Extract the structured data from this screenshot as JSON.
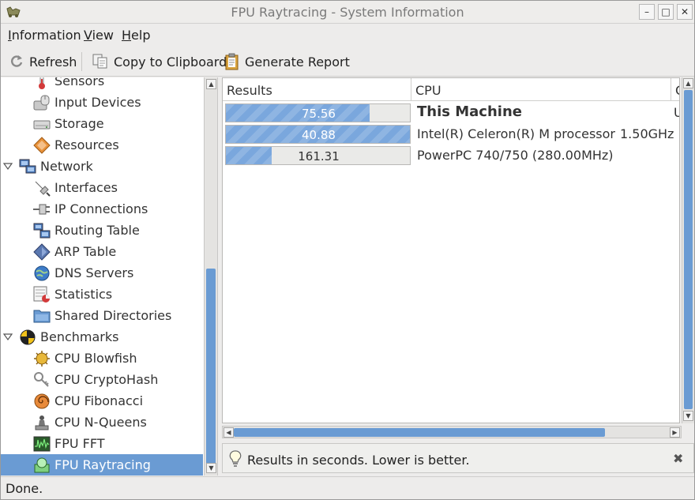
{
  "window": {
    "title": "FPU Raytracing - System Information",
    "minimize": "–",
    "maximize": "□",
    "close": "✕"
  },
  "menu": [
    {
      "mnemonic": "I",
      "rest": "nformation"
    },
    {
      "mnemonic": "V",
      "rest": "iew"
    },
    {
      "mnemonic": "H",
      "rest": "elp"
    }
  ],
  "toolbar": {
    "refresh": "Refresh",
    "copy": "Copy to Clipboard",
    "report": "Generate Report"
  },
  "sidebar": {
    "items": [
      {
        "label": "Sensors",
        "icon": "thermometer-icon"
      },
      {
        "label": "Input Devices",
        "icon": "input-devices-icon"
      },
      {
        "label": "Storage",
        "icon": "storage-icon"
      },
      {
        "label": "Resources",
        "icon": "resources-icon"
      },
      {
        "label": "Network",
        "icon": "network-icon",
        "group": true
      },
      {
        "label": "Interfaces",
        "icon": "interfaces-icon"
      },
      {
        "label": "IP Connections",
        "icon": "ip-connections-icon"
      },
      {
        "label": "Routing Table",
        "icon": "routing-table-icon"
      },
      {
        "label": "ARP Table",
        "icon": "arp-table-icon"
      },
      {
        "label": "DNS Servers",
        "icon": "dns-servers-icon"
      },
      {
        "label": "Statistics",
        "icon": "statistics-icon"
      },
      {
        "label": "Shared Directories",
        "icon": "shared-directories-icon"
      },
      {
        "label": "Benchmarks",
        "icon": "benchmarks-icon",
        "group": true
      },
      {
        "label": "CPU Blowfish",
        "icon": "blowfish-icon"
      },
      {
        "label": "CPU CryptoHash",
        "icon": "cryptohash-icon"
      },
      {
        "label": "CPU Fibonacci",
        "icon": "fibonacci-icon"
      },
      {
        "label": "CPU N-Queens",
        "icon": "n-queens-icon"
      },
      {
        "label": "FPU FFT",
        "icon": "fft-icon"
      },
      {
        "label": "FPU Raytracing",
        "icon": "raytracing-icon",
        "selected": true
      }
    ]
  },
  "results": {
    "columns": [
      "Results",
      "CPU",
      "C"
    ],
    "rows": [
      {
        "value": "75.56",
        "fill": 0.78,
        "cpu": "This Machine",
        "freq": "",
        "extra": "U",
        "bold": true
      },
      {
        "value": "40.88",
        "fill": 1.0,
        "cpu": "Intel(R) Celeron(R) M processor",
        "freq": "1.50GHz",
        "extra": "",
        "bold": false
      },
      {
        "value": "161.31",
        "fill": 0.25,
        "cpu": "PowerPC 740/750 (280.00MHz)",
        "freq": "",
        "extra": "",
        "bold": false
      }
    ]
  },
  "info": {
    "message": "Results in seconds. Lower is better."
  },
  "status": {
    "text": "Done."
  },
  "colors": {
    "accent": "#6a9bd3",
    "bar": "#7aa7dd"
  }
}
